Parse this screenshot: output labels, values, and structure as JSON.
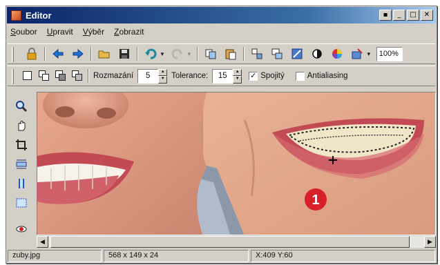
{
  "window": {
    "title": "Editor"
  },
  "window_buttons": [
    "▪",
    "_",
    "□",
    "✕"
  ],
  "menu": [
    "Soubor",
    "Upravit",
    "Výběr",
    "Zobrazit"
  ],
  "toolbar": {
    "zoom": "100%"
  },
  "selection_bar": {
    "feather_label": "Rozmazání",
    "feather_value": "5",
    "tolerance_label": "Tolerance:",
    "tolerance_value": "15",
    "contiguous_label": "Spojitý",
    "contiguous_checked": true,
    "antialias_label": "Antialiasing",
    "antialias_checked": false
  },
  "canvas": {
    "marker_number": "1"
  },
  "status": {
    "file": "zuby.jpg",
    "image_info": "568 x 149 x 24",
    "cursor": "X:409  Y:60"
  },
  "colors": {
    "title_start": "#0a246a",
    "title_end": "#a6caf0",
    "chrome": "#d4d0c8",
    "marker": "#d8202a"
  }
}
